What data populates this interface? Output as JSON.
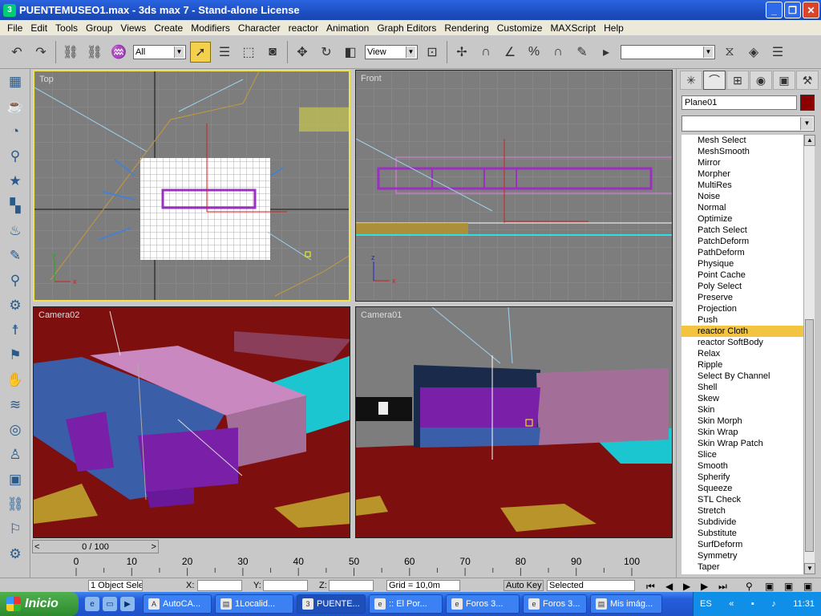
{
  "window": {
    "title": "PUENTEMUSEO1.max - 3ds max 7 - Stand-alone License",
    "app_icon": "3ds-max-icon",
    "controls": {
      "minimize": "_",
      "restore": "❐",
      "close": "✕"
    }
  },
  "menu": [
    "File",
    "Edit",
    "Tools",
    "Group",
    "Views",
    "Create",
    "Modifiers",
    "Character",
    "reactor",
    "Animation",
    "Graph Editors",
    "Rendering",
    "Customize",
    "MAXScript",
    "Help"
  ],
  "toolbar": {
    "selection_filter": "All",
    "reference_coord": "View",
    "named_selection": ""
  },
  "viewports": {
    "top": {
      "label": "Top"
    },
    "front": {
      "label": "Front"
    },
    "camera02": {
      "label": "Camera02"
    },
    "camera01": {
      "label": "Camera01"
    }
  },
  "command_panel": {
    "object_name": "Plane01",
    "object_color": "#8b0000",
    "modifier_list_value": "",
    "modifiers": [
      "Mesh Select",
      "MeshSmooth",
      "Mirror",
      "Morpher",
      "MultiRes",
      "Noise",
      "Normal",
      "Optimize",
      "Patch Select",
      "PatchDeform",
      "PathDeform",
      "Physique",
      "Point Cache",
      "Poly Select",
      "Preserve",
      "Projection",
      "Push",
      "reactor Cloth",
      "reactor SoftBody",
      "Relax",
      "Ripple",
      "Select By Channel",
      "Shell",
      "Skew",
      "Skin",
      "Skin Morph",
      "Skin Wrap",
      "Skin Wrap Patch",
      "Slice",
      "Smooth",
      "Spherify",
      "Squeeze",
      "STL Check",
      "Stretch",
      "Subdivide",
      "Substitute",
      "SurfDeform",
      "Symmetry",
      "Taper"
    ],
    "selected_modifier": "reactor Cloth"
  },
  "timeline": {
    "frame_label": "0 / 100",
    "ticks": [
      "0",
      "10",
      "20",
      "30",
      "40",
      "50",
      "60",
      "70",
      "80",
      "90",
      "100"
    ]
  },
  "status": {
    "selection": "1 Object Sele",
    "x_label": "X:",
    "y_label": "Y:",
    "z_label": "Z:",
    "x_value": "",
    "y_value": "",
    "z_value": "",
    "grid": "Grid = 10,0m",
    "auto_key": "Auto Key",
    "key_mode": "Selected"
  },
  "taskbar": {
    "start": "Inicio",
    "tasks": [
      {
        "label": "AutoCA...",
        "icon": "autocad-icon"
      },
      {
        "label": "1Localid...",
        "icon": "folder-icon"
      },
      {
        "label": "PUENTE...",
        "icon": "3ds-max-icon"
      },
      {
        "label": ":: El Por...",
        "icon": "ie-icon"
      },
      {
        "label": "Foros 3...",
        "icon": "ie-icon"
      },
      {
        "label": "Foros 3...",
        "icon": "ie-icon"
      },
      {
        "label": "Mis imág...",
        "icon": "folder-icon"
      }
    ],
    "language": "ES",
    "clock": "11:31"
  },
  "colors": {
    "active_viewport_border": "#f2e24a",
    "selection_highlight": "#f2c440",
    "taskbar_blue": "#245ddb"
  }
}
